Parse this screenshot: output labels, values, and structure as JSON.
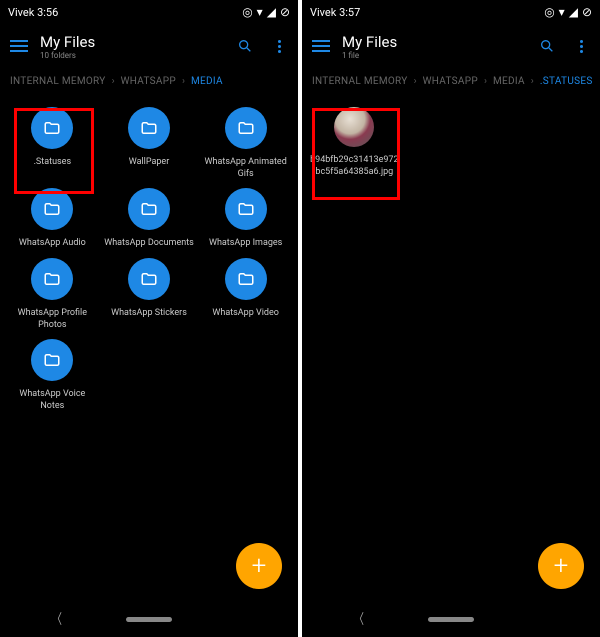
{
  "colors": {
    "accent": "#1e88e5",
    "fab": "#ffa500",
    "highlight": "#ff0000"
  },
  "left": {
    "status": {
      "left": "Vivek 3:56",
      "icons": [
        "vibrate",
        "wifi",
        "signal",
        "nosim"
      ]
    },
    "title": "My Files",
    "subtitle": "10 folders",
    "breadcrumb": [
      {
        "label": "INTERNAL MEMORY",
        "active": false
      },
      {
        "label": "WHATSAPP",
        "active": false
      },
      {
        "label": "MEDIA",
        "active": true
      }
    ],
    "folders": [
      {
        "label": ".Statuses",
        "highlight": true
      },
      {
        "label": "WallPaper"
      },
      {
        "label": "WhatsApp Animated Gifs"
      },
      {
        "label": "WhatsApp Audio"
      },
      {
        "label": "WhatsApp Documents"
      },
      {
        "label": "WhatsApp Images"
      },
      {
        "label": "WhatsApp Profile Photos"
      },
      {
        "label": "WhatsApp Stickers"
      },
      {
        "label": "WhatsApp Video"
      },
      {
        "label": "WhatsApp Voice Notes"
      }
    ]
  },
  "right": {
    "status": {
      "left": "Vivek 3:57",
      "icons": [
        "vibrate",
        "wifi",
        "signal",
        "nosim"
      ]
    },
    "title": "My Files",
    "subtitle": "1 file",
    "breadcrumb": [
      {
        "label": "INTERNAL MEMORY",
        "active": false
      },
      {
        "label": "WHATSAPP",
        "active": false
      },
      {
        "label": "MEDIA",
        "active": false
      },
      {
        "label": ".STATUSES",
        "active": true
      }
    ],
    "files": [
      {
        "label": "b94bfb29c31413e972bc5f5a64385a6.jpg",
        "highlight": true
      }
    ]
  }
}
